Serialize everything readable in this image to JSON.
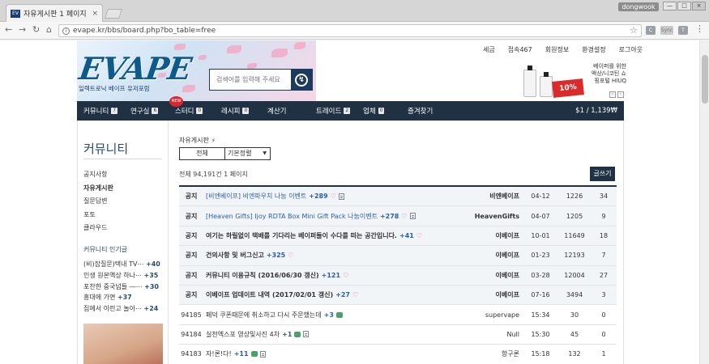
{
  "browser": {
    "tab_title": "자유게시판 1 페이지 | E",
    "tab_close": "×",
    "user": "dongwook",
    "url": "evape.kr/bbs/board.php?bo_table=free",
    "win_min": "—",
    "win_max": "□",
    "win_close": "×",
    "nav_back": "←",
    "nav_forward": "→",
    "nav_reload": "↻",
    "nav_home": "⌂",
    "star": "☆",
    "menu": "⋮",
    "ext": [
      "C",
      "Sync",
      "T"
    ],
    "ext_colors": [
      "#9aa0a6",
      "#c9c9c9",
      "#9aa0a6"
    ]
  },
  "header": {
    "util": [
      "세금",
      "접속467",
      "회원정보",
      "환경설정",
      "로그아웃"
    ],
    "logo": "EVAPE",
    "slogan": "일렉트로닉 베이프 유저포럼",
    "search_placeholder": "검색어를 입력해 주세요",
    "search_icon": "↯",
    "ad_text": "베이퍼를 위한 액상/니코틴 쇼핑포털 HIUQ",
    "ad_badge": "10%",
    "ad_prev": "‹",
    "ad_next": "›"
  },
  "gnb": {
    "new_badge": "NEW",
    "items": [
      {
        "label": "커뮤니티",
        "count": "7"
      },
      {
        "label": "연구실",
        "count": "6"
      },
      {
        "label": "스터디",
        "count": "0"
      },
      {
        "label": "레시피",
        "count": "0"
      },
      {
        "label": "계산기",
        "count": ""
      },
      {
        "label": "트레이드",
        "count": "2"
      },
      {
        "label": "업체",
        "count": "0"
      },
      {
        "label": "즐겨찾기",
        "count": ""
      }
    ],
    "price": "$1 / 1,139₩"
  },
  "sidebar": {
    "title": "커뮤니티",
    "menu": [
      "공지사항",
      "자유게시판",
      "질문답변",
      "포토",
      "클라우드"
    ],
    "active_index": 1,
    "popular_title": "커뮤니티 인기글",
    "popular": [
      {
        "text": "(비)잡질문)택내 TV⋯",
        "count": "+40"
      },
      {
        "text": "인생 원본액상 하나⋯",
        "count": "+35"
      },
      {
        "text": "포찬한 중국넘들 ―⋯",
        "count": "+30"
      },
      {
        "text": "흥대에 가면",
        "count": "+37"
      },
      {
        "text": "집에서 이런고 놀아⋯",
        "count": "+24"
      }
    ]
  },
  "board": {
    "breadcrumb": "자유게시판",
    "rss_icon": "⚡",
    "filter_all": "전체",
    "filter_sort": "기본정렬",
    "filter_arrow": "▼",
    "total": "전체 94,191건 1 페이지",
    "write_button": "글쓰기",
    "rows": [
      {
        "num": "공지",
        "notice": true,
        "subject": "[비엔베이프] 비엔파우치 나눔 이벤트",
        "blue": true,
        "comments": "+289",
        "icons": [
          "heart",
          "doc"
        ],
        "name": "비엔베이프",
        "date": "04-12",
        "hits": "1226",
        "rec": "34"
      },
      {
        "num": "공지",
        "notice": true,
        "subject": "[Heaven Gifts] Ijoy RDTA Box Mini Gift Pack 나눔이벤트",
        "blue": true,
        "comments": "+278",
        "icons": [
          "heart",
          "doc"
        ],
        "name": "HeavenGifts",
        "date": "04-07",
        "hits": "1205",
        "rec": "9"
      },
      {
        "num": "공지",
        "notice": true,
        "subject": "여기는 하릴없이 택배를 기다리는 베이퍼들이 수다를 떠는 공간입니다.",
        "blue": false,
        "comments": "+41",
        "icons": [
          "heart"
        ],
        "name": "이베이프",
        "date": "10-01",
        "hits": "11649",
        "rec": "18"
      },
      {
        "num": "공지",
        "notice": true,
        "subject": "건의사항 및 버그신고",
        "blue": false,
        "comments": "+325",
        "icons": [
          "heart"
        ],
        "name": "이베이프",
        "date": "01-23",
        "hits": "12193",
        "rec": "7"
      },
      {
        "num": "공지",
        "notice": true,
        "subject": "커뮤니티 이용규칙 (2016/06/30 갱신)",
        "blue": false,
        "comments": "+121",
        "icons": [
          "heart"
        ],
        "name": "이베이프",
        "date": "03-28",
        "hits": "12004",
        "rec": "27"
      },
      {
        "num": "공지",
        "notice": true,
        "subject": "이베이프 업데이트 내역 (2017/02/01 갱신)",
        "blue": false,
        "comments": "+27",
        "icons": [
          "heart"
        ],
        "name": "이베이프",
        "date": "07-16",
        "hits": "3494",
        "rec": "3"
      },
      {
        "num": "94185",
        "notice": false,
        "subject": "페덕 쿠폰때문에 취소하고 다시 주문했는데",
        "blue": false,
        "comments": "+3",
        "icons": [
          "speech"
        ],
        "name": "supervape",
        "date": "15:34",
        "hits": "30",
        "rec": "0"
      },
      {
        "num": "94184",
        "notice": false,
        "subject": "실천엑스포 영상및사진 4차",
        "blue": false,
        "comments": "+1",
        "icons": [
          "speech",
          "doc"
        ],
        "name": "Null",
        "date": "15:30",
        "hits": "45",
        "rec": "0"
      },
      {
        "num": "94183",
        "notice": false,
        "subject": "자!론!다!",
        "blue": false,
        "comments": "+11",
        "icons": [
          "speech",
          "doc"
        ],
        "name": "항구론",
        "date": "15:18",
        "hits": "132",
        "rec": "1"
      }
    ]
  }
}
